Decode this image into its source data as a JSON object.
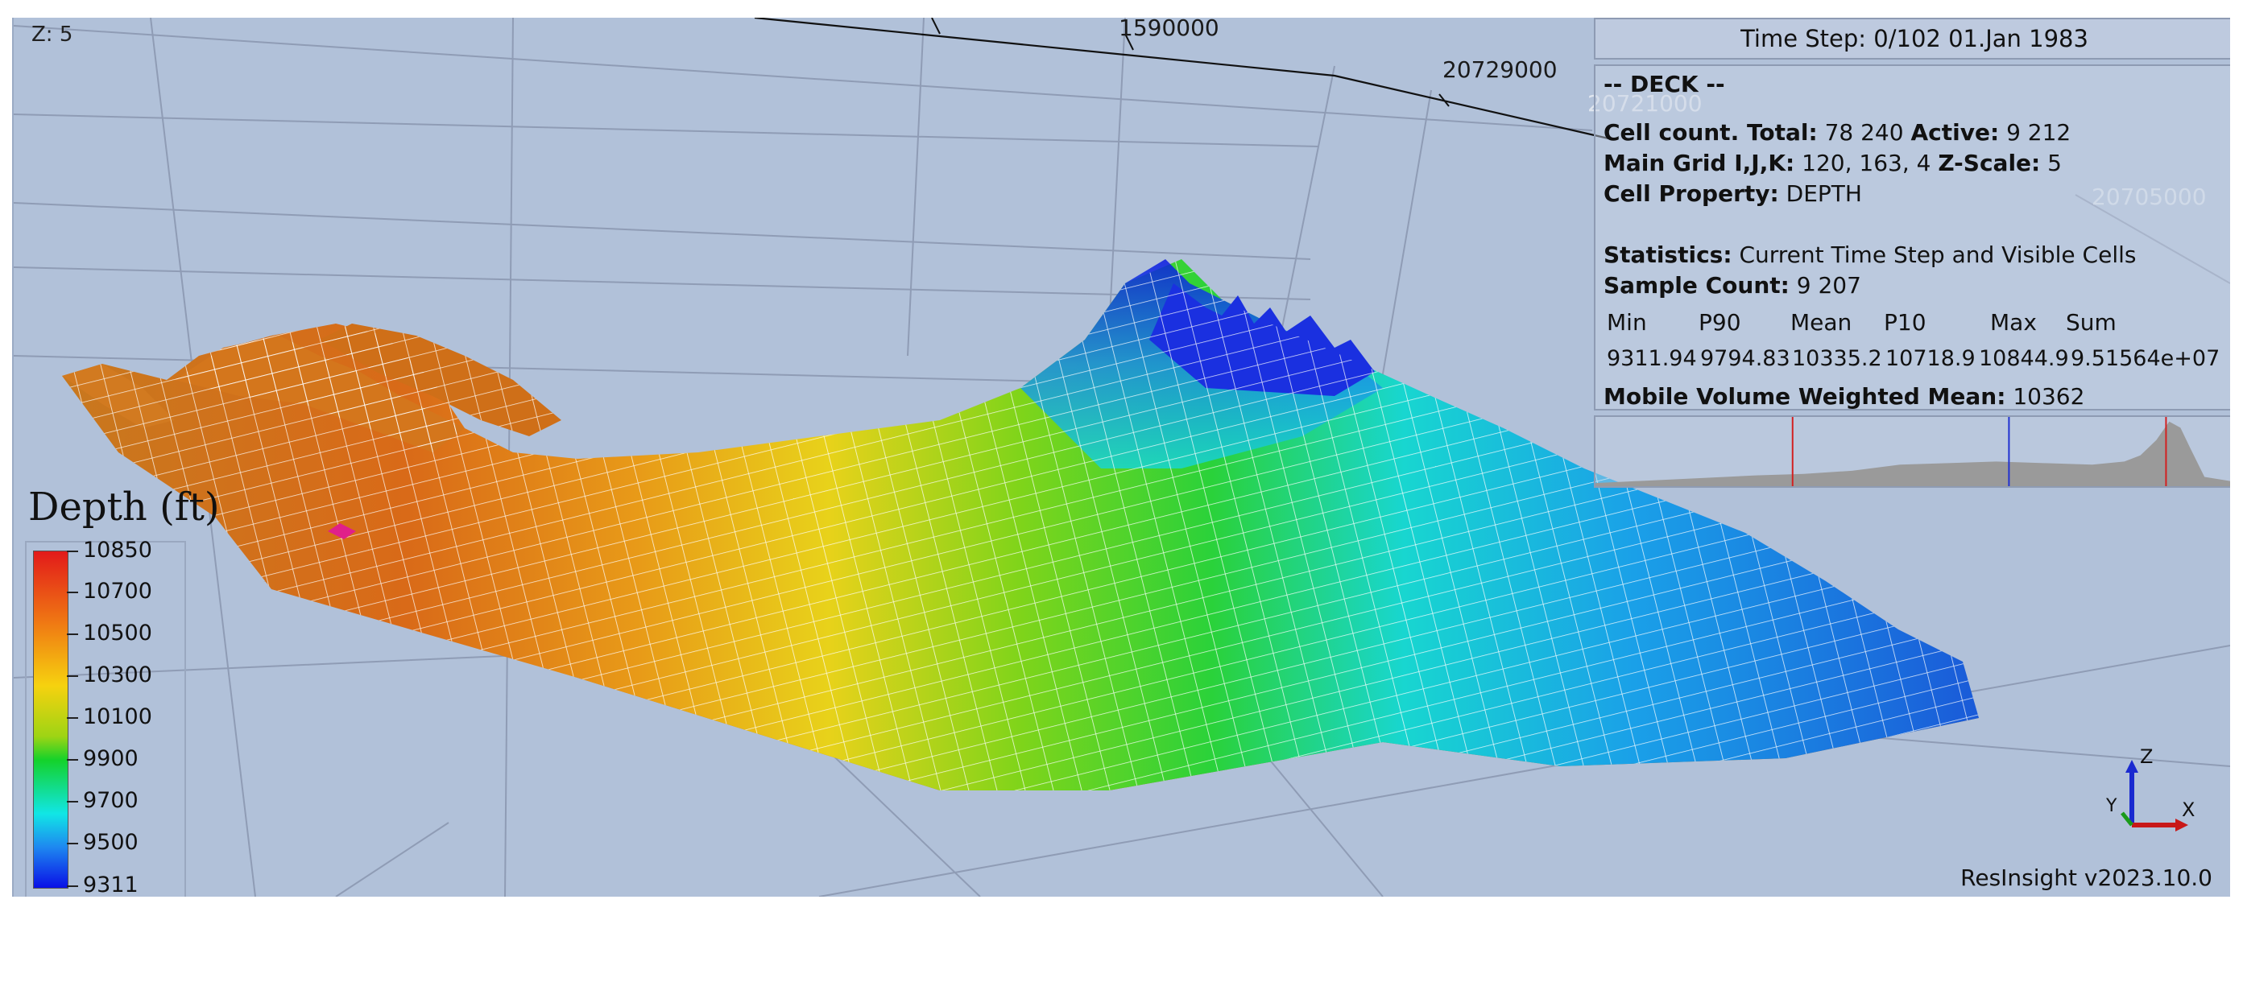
{
  "viewport": {
    "z_label": "Z: 5",
    "axis_labels": [
      "1590000",
      "20729000",
      "20721000",
      "20705000"
    ],
    "version": "ResInsight v2023.10.0"
  },
  "info": {
    "time_step": "Time Step: 0/102 01.Jan 1983",
    "deck_title": "-- DECK --",
    "cell_count_label": "Cell count. Total:",
    "cell_count_total": "78 240",
    "active_label": "Active:",
    "active_value": "9 212",
    "main_grid_label": "Main Grid I,J,K:",
    "main_grid_value": "120, 163, 4",
    "zscale_label": "Z-Scale:",
    "zscale_value": "5",
    "cell_property_label": "Cell Property:",
    "cell_property_value": "DEPTH",
    "statistics_label": "Statistics:",
    "statistics_value": "Current Time Step and Visible Cells",
    "sample_count_label": "Sample Count:",
    "sample_count_value": "9 207",
    "stat_headers": [
      "Min",
      "P90",
      "Mean",
      "P10",
      "Max",
      "Sum"
    ],
    "stat_values": [
      "9311.94",
      "9794.83",
      "10335.2",
      "10718.9",
      "10844.9",
      "9.51564e+07"
    ],
    "mobile_label": "Mobile Volume Weighted Mean:",
    "mobile_value": "10362"
  },
  "legend": {
    "title": "Depth (ft)",
    "ticks": [
      "10850",
      "10700",
      "10500",
      "10300",
      "10100",
      "9900",
      "9700",
      "9500",
      "9311"
    ]
  },
  "triad": {
    "z": "Z",
    "y": "Y",
    "x": "X"
  },
  "colors": {
    "background": "#b1c1d9",
    "p_marker": "#d22020",
    "mean_marker": "#2030d0"
  }
}
